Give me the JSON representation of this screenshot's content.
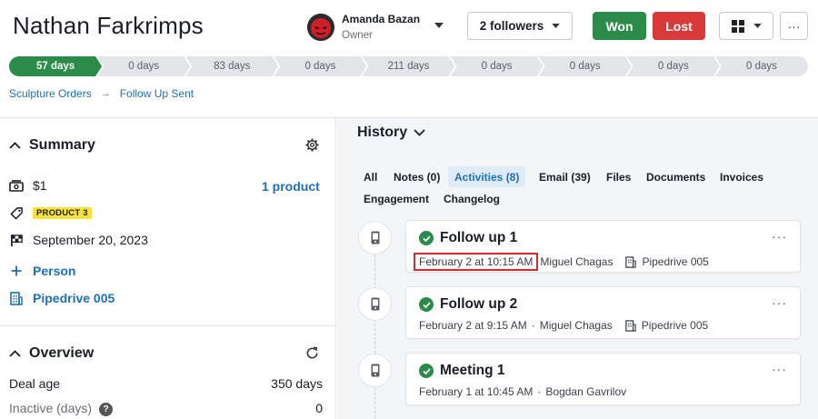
{
  "header": {
    "title": "Nathan Farkrimps",
    "owner_name": "Amanda Bazan",
    "owner_role": "Owner",
    "followers_label": "2 followers",
    "won_label": "Won",
    "lost_label": "Lost",
    "more_label": "···"
  },
  "pipeline": [
    {
      "label": "57 days",
      "active": true
    },
    {
      "label": "0 days"
    },
    {
      "label": "83 days"
    },
    {
      "label": "0 days"
    },
    {
      "label": "211 days"
    },
    {
      "label": "0 days"
    },
    {
      "label": "0 days"
    },
    {
      "label": "0 days"
    },
    {
      "label": "0 days"
    }
  ],
  "breadcrumb": {
    "pipeline": "Sculpture Orders",
    "stage": "Follow Up Sent"
  },
  "summary": {
    "heading": "Summary",
    "value": "$1",
    "product_link": "1 product",
    "tag": "PRODUCT 3",
    "close_date": "September 20, 2023",
    "person_link": "Person",
    "org_link": "Pipedrive 005"
  },
  "overview": {
    "heading": "Overview",
    "deal_age_label": "Deal age",
    "deal_age_value": "350 days",
    "inactive_label": "Inactive (days)",
    "inactive_value": "0"
  },
  "history": {
    "heading": "History",
    "tabs": [
      {
        "label": "All"
      },
      {
        "label": "Notes (0)"
      },
      {
        "label": "Activities (8)",
        "active": true
      },
      {
        "label": "Email (39)"
      },
      {
        "label": "Files"
      },
      {
        "label": "Documents"
      },
      {
        "label": "Invoices"
      },
      {
        "label": "Engagement"
      },
      {
        "label": "Changelog"
      }
    ],
    "activities": [
      {
        "title": "Follow up 1",
        "datetime": "February 2 at 10:15 AM",
        "user": "Miguel Chagas",
        "org": "Pipedrive 005"
      },
      {
        "title": "Follow up 2",
        "datetime": "February 2 at 9:15 AM",
        "user": "Miguel Chagas",
        "org": "Pipedrive 005"
      },
      {
        "title": "Meeting 1",
        "datetime": "February 1 at 10:45 AM",
        "user": "Bogdan Gavrilov"
      }
    ],
    "meta_separator": "·"
  },
  "colors": {
    "accent": "#2a8c48",
    "danger": "#d83a3a",
    "link": "#1e6fb8",
    "highlight": "#d42b2b",
    "tag": "#f8e13c"
  },
  "icons": [
    "avatar",
    "chevron-down-icon",
    "grid-icon",
    "gear-icon",
    "money-icon",
    "tag-icon",
    "flag-icon",
    "plus-icon",
    "building-icon",
    "refresh-icon",
    "help-icon",
    "phone-icon",
    "check-icon"
  ]
}
